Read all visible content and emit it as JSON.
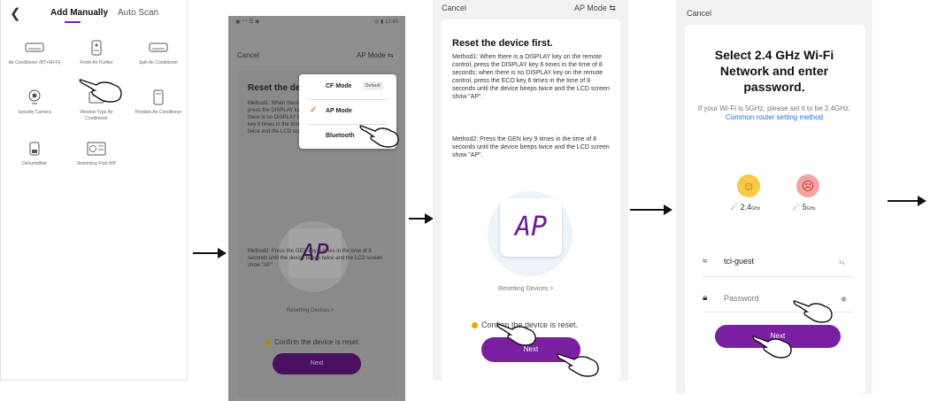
{
  "panel1": {
    "tabs": {
      "active": "Add Manually",
      "inactive": "Auto Scan"
    },
    "devices": [
      {
        "label": "Air Conditioner (BT+Wi-Fi)",
        "icon": "air-conditioner-icon"
      },
      {
        "label": "Fresh Air Purifier",
        "icon": "air-purifier-icon"
      },
      {
        "label": "Split Air Conditioner",
        "icon": "split-ac-icon"
      },
      {
        "label": "Security Camera",
        "icon": "security-camera-icon"
      },
      {
        "label": "Window Type Air Conditioner",
        "icon": "window-ac-icon"
      },
      {
        "label": "Portable Air Conditioner",
        "icon": "portable-ac-icon"
      },
      {
        "label": "Dehumidifier",
        "icon": "dehumidifier-icon"
      },
      {
        "label": "Swimming Pool H/P",
        "icon": "pool-heat-pump-icon"
      }
    ]
  },
  "panel2": {
    "status_left": "▣ ᵊ ᵊ ☰ ◉",
    "status_right": "◎ ▮ 12:45",
    "cancel": "Cancel",
    "mode": "AP Mode",
    "title": "Reset the device first.",
    "method1_partial": "Method1: When there is a DISPLAY key on the remote control, press the DISPLAY key 6 times in the time of 8 seconds; when there is no DISPLAY key on the remote control, press the ECO key 6 times in the time of 8 seconds until the device beeps twice and the LCD screen show \"AP\".",
    "method2": "Method2: Press the GEN key 9 times in the time of 8 seconds until the device beeps twice and the LCD screen show \"AP\".",
    "lcd": "AP",
    "resetting": "Resetting Devices >",
    "confirm": "Confirm the device is reset.",
    "next": "Next",
    "menu": {
      "cf_mode": "CF Mode",
      "default_badge": "Default",
      "ap_mode": "AP Mode",
      "bluetooth": "Bluetooth"
    }
  },
  "panel3": {
    "cancel": "Cancel",
    "mode": "AP Mode",
    "title": "Reset the device first.",
    "method1": "Method1: When there is a DISPLAY key on the remote control, press the DISPLAY key 6 times in the time of 8 seconds; when there is no DISPLAY key on the remote control, press the ECO key 6 times in the time of 8 seconds until the device beeps twice and the LCD screen show \"AP\".",
    "method2": "Method2: Press the GEN key 9 times in the time of 8 seconds until the device beeps twice and the LCD screen show \"AP\".",
    "lcd": "AP",
    "resetting": "Resetting Devices >",
    "confirm": "Confirm the device is reset.",
    "next": "Next"
  },
  "panel4": {
    "cancel": "Cancel",
    "title": "Select 2.4 GHz Wi-Fi Network and enter password.",
    "hint": "If your Wi-Fi is 5GHz, please set it to be 2.4GHz.",
    "hint_link": "Common router setting method",
    "band_24": "2.4",
    "band_24_unit": "GHz",
    "band_5": "5",
    "band_5_unit": "GHz",
    "ssid": "tcl-guest",
    "password_placeholder": "Password",
    "next": "Next"
  },
  "colors": {
    "accent": "#7b1fa2",
    "link": "#1a73e8",
    "check": "#e07a2a"
  }
}
